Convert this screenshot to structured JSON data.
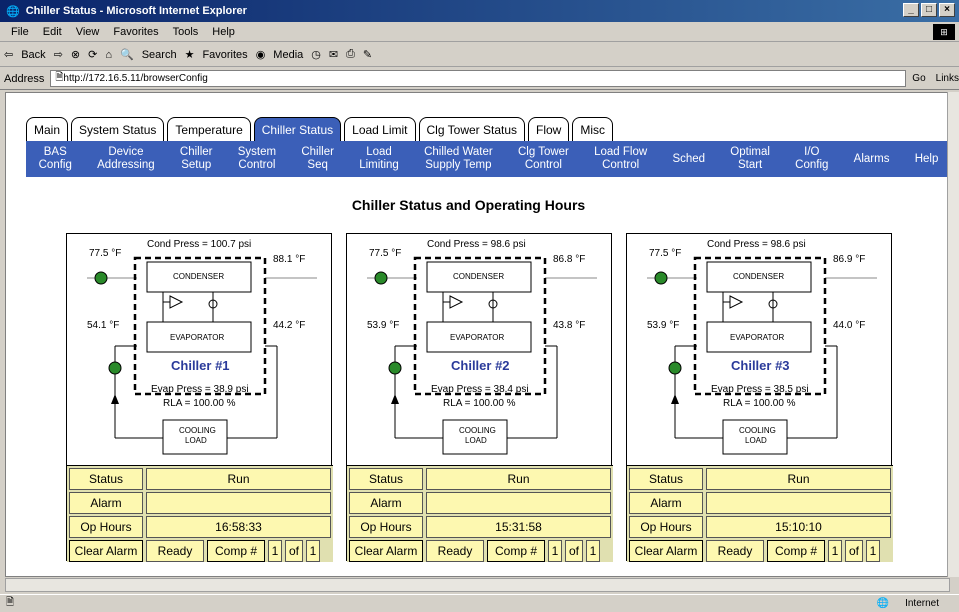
{
  "window": {
    "title": "Chiller Status - Microsoft Internet Explorer"
  },
  "menu": [
    "File",
    "Edit",
    "View",
    "Favorites",
    "Tools",
    "Help"
  ],
  "toolbar": {
    "back": "Back",
    "search": "Search",
    "favorites": "Favorites",
    "media": "Media"
  },
  "address": {
    "label": "Address",
    "url": "http://172.16.5.11/browserConfig",
    "go": "Go",
    "links": "Links"
  },
  "tabs": [
    "Main",
    "System Status",
    "Temperature",
    "Chiller Status",
    "Load Limit",
    "Clg Tower Status",
    "Flow",
    "Misc"
  ],
  "nav": [
    [
      "BAS",
      "Config"
    ],
    [
      "Device",
      "Addressing"
    ],
    [
      "Chiller",
      "Setup"
    ],
    [
      "System",
      "Control"
    ],
    [
      "Chiller",
      "Seq"
    ],
    [
      "Load",
      "Limiting"
    ],
    [
      "Chilled Water",
      "Supply Temp"
    ],
    [
      "Clg Tower",
      "Control"
    ],
    [
      "Load Flow",
      "Control"
    ],
    [
      "Sched",
      ""
    ],
    [
      "Optimal",
      "Start"
    ],
    [
      "I/O",
      "Config"
    ],
    [
      "Alarms",
      ""
    ],
    [
      "Help",
      ""
    ]
  ],
  "heading": "Chiller Status and Operating Hours",
  "labels": {
    "condenser": "CONDENSER",
    "evaporator": "EVAPORATOR",
    "cooling": "COOLING",
    "load": "LOAD",
    "status": "Status",
    "alarm": "Alarm",
    "ophours": "Op Hours",
    "clear": "Clear Alarm",
    "comp": "Comp #",
    "of": "of"
  },
  "chillers": [
    {
      "name": "Chiller #1",
      "cond_press": "Cond Press = 100.7 psi",
      "t_in": "77.5 °F",
      "t_out": "88.1 °F",
      "t_evap_in": "54.1 °F",
      "t_evap_out": "44.2 °F",
      "evap_press": "Evap Press = 38.9 psi",
      "rla": "RLA = 100.00 %",
      "status": "Run",
      "alarm": "",
      "hours": "16:58:33",
      "ready": "Ready",
      "comp": "1",
      "comp_of": "1"
    },
    {
      "name": "Chiller #2",
      "cond_press": "Cond Press =  98.6 psi",
      "t_in": "77.5 °F",
      "t_out": "86.8 °F",
      "t_evap_in": "53.9 °F",
      "t_evap_out": "43.8 °F",
      "evap_press": "Evap Press = 38.4 psi",
      "rla": "RLA = 100.00 %",
      "status": "Run",
      "alarm": "",
      "hours": "15:31:58",
      "ready": "Ready",
      "comp": "1",
      "comp_of": "1"
    },
    {
      "name": "Chiller #3",
      "cond_press": "Cond Press =  98.6 psi",
      "t_in": "77.5 °F",
      "t_out": "86.9 °F",
      "t_evap_in": "53.9 °F",
      "t_evap_out": "44.0 °F",
      "evap_press": "Evap Press = 38.5 psi",
      "rla": "RLA = 100.00 %",
      "status": "Run",
      "alarm": "",
      "hours": "15:10:10",
      "ready": "Ready",
      "comp": "1",
      "comp_of": "1"
    }
  ],
  "statusbar": {
    "zone": "Internet"
  }
}
